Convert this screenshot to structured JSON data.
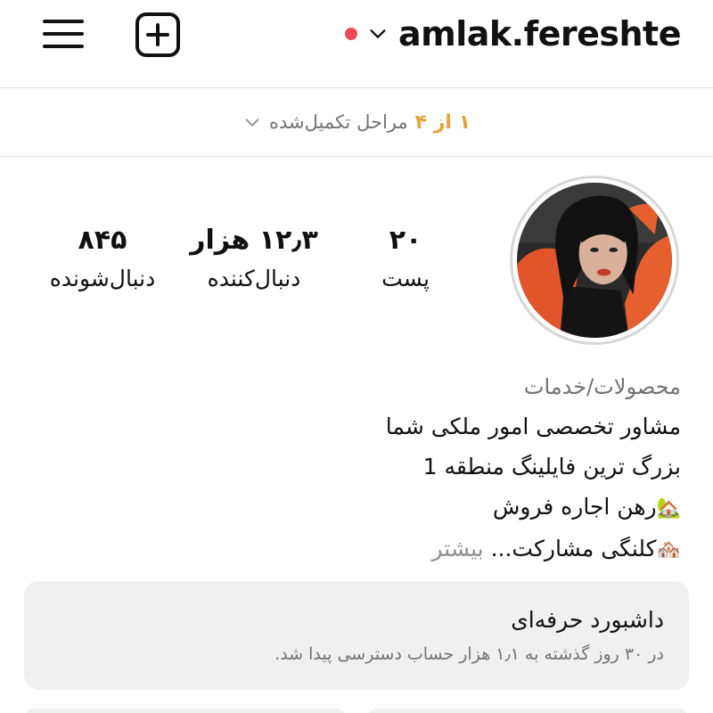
{
  "header": {
    "username": "amlak.fereshte",
    "live_dot_color": "#ed4956",
    "icons": [
      "menu-icon",
      "add-post-icon",
      "chevron-down-icon"
    ]
  },
  "progress": {
    "count": "۱ از ۴",
    "label": "مراحل تکمیل‌شده",
    "count_color": "#e6a23c"
  },
  "stats": {
    "posts": {
      "value": "۲۰",
      "label": "پست"
    },
    "followers": {
      "value": "۱۲٫۳ هزار",
      "label": "دنبال‌کننده"
    },
    "following": {
      "value": "۸۴۵",
      "label": "دنبال‌شونده"
    }
  },
  "bio": {
    "category": "محصولات/خدمات",
    "line1": "مشاور تخصصی امور ملکی شما",
    "line2": "بزرگ ترین فایلینگ منطقه 1",
    "line3_emoji": "🏡",
    "line3": "رهن اجاره فروش",
    "line4_emoji": "🏘️",
    "line4": "کلنگی مشارکت...",
    "more": "بیشتر"
  },
  "dashboard": {
    "title": "داشبورد حرفه‌ای",
    "subtitle": "در ۳۰ روز گذشته به ۱٫۱ هزار حساب دسترسی پیدا شد."
  }
}
